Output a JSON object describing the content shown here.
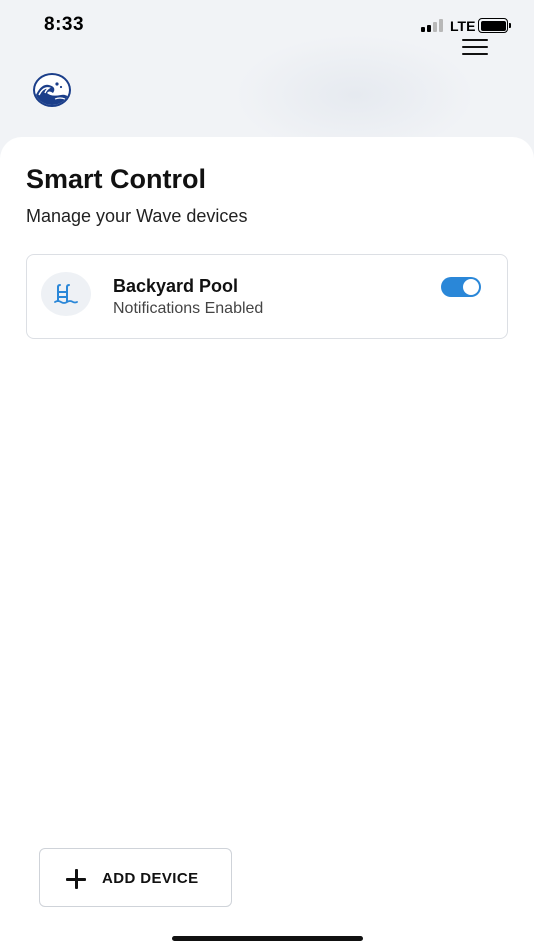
{
  "status_bar": {
    "time": "8:33",
    "network": "LTE",
    "signal_bars_active": 2,
    "signal_bars_total": 4,
    "battery_level": 1.0
  },
  "header": {
    "logo_icon": "wave-logo-icon",
    "menu_icon": "hamburger-menu-icon"
  },
  "page": {
    "title": "Smart Control",
    "subtitle": "Manage your Wave devices"
  },
  "devices": [
    {
      "name": "Backyard Pool",
      "status": "Notifications Enabled",
      "icon": "pool-ladder-icon",
      "enabled": true
    }
  ],
  "actions": {
    "add_device_label": "ADD DEVICE",
    "add_icon": "plus-icon"
  },
  "colors": {
    "accent": "#2a87d8",
    "background": "#f1f3f6",
    "card": "#ffffff",
    "logo_blue": "#1b3e8a"
  }
}
